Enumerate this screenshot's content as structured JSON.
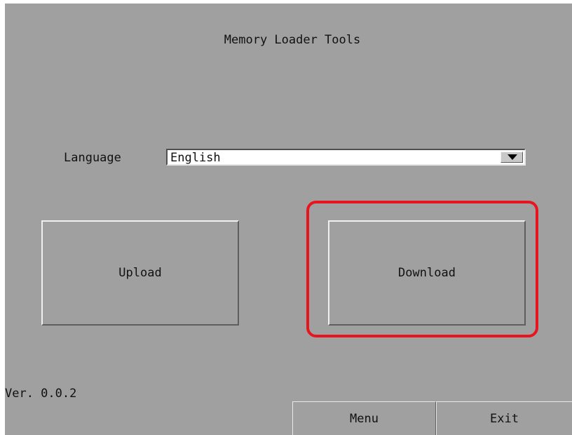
{
  "screen": {
    "title": "Memory Loader Tools",
    "background_color": "#a0a0a0"
  },
  "language": {
    "label": "Language",
    "selected": "English",
    "arrow_icon": "triangle-down-icon"
  },
  "actions": {
    "upload_label": "Upload",
    "download_label": "Download"
  },
  "highlight": {
    "target": "download-button",
    "color": "#e8141e"
  },
  "footer": {
    "version": "Ver. 0.0.2",
    "menu_label": "Menu",
    "exit_label": "Exit"
  }
}
